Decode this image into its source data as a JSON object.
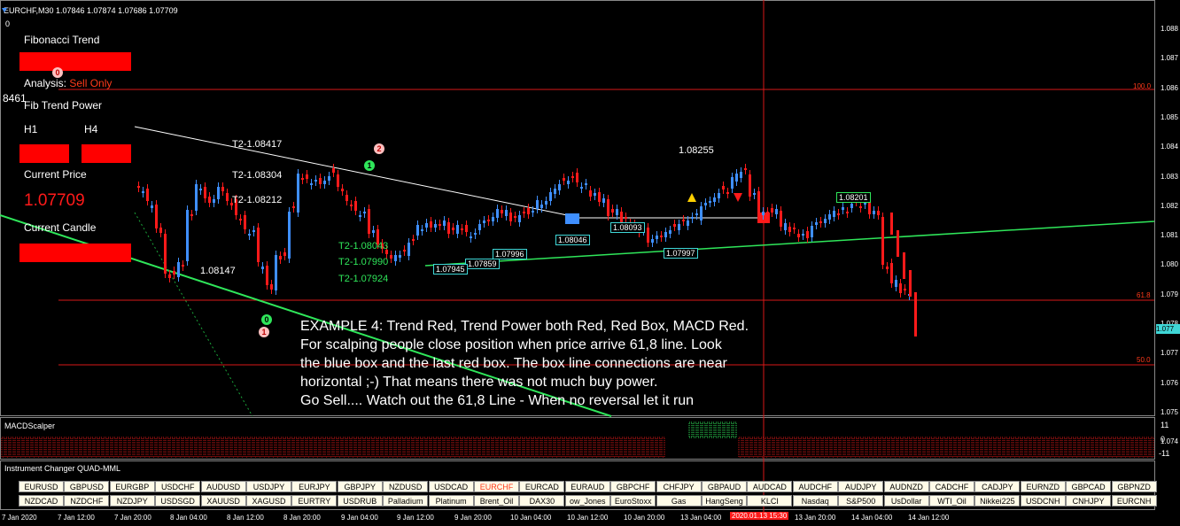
{
  "window": {
    "title": "EURCHF,M30  1.07846 1.07874 1.07686 1.07709",
    "zero_label": "0"
  },
  "panel": {
    "fib_trend": "Fibonacci Trend",
    "analysis_label": "Analysis:",
    "analysis_value": "Sell Only",
    "fib_trend_power": "Fib Trend Power",
    "h1": "H1",
    "h4": "H4",
    "current_price_label": "Current Price",
    "current_price_value": "1.07709",
    "current_candle": "Current Candle",
    "side_value": "8461"
  },
  "chart": {
    "annotations": {
      "t2_1": "T2-1.08417",
      "t2_2": "T2-1.08304",
      "t2_3": "T2-1.08212",
      "t2_4": "T2-1.08043",
      "t2_5": "T2-1.07990",
      "t2_6": "T2-1.07924",
      "low_label": "1.08147",
      "high_label": "1.08255",
      "box_1": "1.08046",
      "box_2": "1.08093",
      "box_3": "1.07996",
      "box_4": "1.07859",
      "box_5": "1.07945",
      "box_6": "1.07997",
      "box_7": "1.08201",
      "lvl_100": "100.0",
      "lvl_61": "61.8",
      "lvl_50": "50.0",
      "circle_0_top": "0",
      "circle_0_bottom": "0",
      "circle_1_bottom": "1",
      "circle_1_top": "1",
      "circle_2": "2"
    },
    "example_lines": [
      "EXAMPLE 4:  Trend Red, Trend Power both Red, Red Box, MACD Red.",
      "For scalping people close position when price arrive 61,8 line.  Look",
      "the blue box and the last red box. The box line connections are near",
      "horizontal ;-)  That means there was not much buy power.",
      "Go Sell.... Watch out the 61,8 Line - When no reversal let it run"
    ],
    "price_scale": [
      "1.088",
      "1.087",
      "1.086",
      "1.085",
      "1.084",
      "1.083",
      "1.082",
      "1.081",
      "1.080",
      "1.079",
      "1.078",
      "1.077",
      "1.076",
      "1.075",
      "1.074"
    ],
    "current_price_tag": "1.077"
  },
  "macd": {
    "title": "MACDScalper",
    "scale": [
      "11",
      "0",
      "-11"
    ]
  },
  "changer": {
    "title": "Instrument Changer QUAD-MML",
    "row1": [
      "EURUSD",
      "GBPUSD",
      "EURGBP",
      "USDCHF",
      "AUDUSD",
      "USDJPY",
      "EURJPY",
      "GBPJPY",
      "NZDUSD",
      "USDCAD",
      "EURCHF",
      "EURCAD",
      "EURAUD",
      "GBPCHF",
      "CHFJPY",
      "GBPAUD",
      "AUDCAD",
      "AUDCHF",
      "AUDJPY",
      "AUDNZD",
      "CADCHF",
      "CADJPY",
      "EURNZD",
      "GBPCAD",
      "GBPNZD"
    ],
    "row2": [
      "NZDCAD",
      "NZDCHF",
      "NZDJPY",
      "USDSGD",
      "XAUUSD",
      "XAGUSD",
      "EURTRY",
      "USDRUB",
      "Palladium",
      "Platinum",
      "Brent_Oil",
      "DAX30",
      "ow_Jones",
      "EuroStoxx",
      "Gas",
      "HangSeng",
      "KLCI",
      "Nasdaq",
      "S&P500",
      "UsDollar",
      "WTI_Oil",
      "Nikkei225",
      "USDCNH",
      "CNHJPY",
      "EURCNH"
    ],
    "active": "EURCHF"
  },
  "time_axis": [
    "7 Jan 2020",
    "7 Jan 12:00",
    "7 Jan 20:00",
    "8 Jan 04:00",
    "8 Jan 12:00",
    "8 Jan 20:00",
    "9 Jan 04:00",
    "9 Jan 12:00",
    "9 Jan 20:00",
    "10 Jan 04:00",
    "10 Jan 12:00",
    "10 Jan 20:00",
    "13 Jan 04:00",
    "2020.01.13 15:30",
    "13 Jan 20:00",
    "14 Jan 04:00",
    "14 Jan 12:00"
  ],
  "colors": {
    "bull": "#3f8fff",
    "bear": "#ff1a1a",
    "trend": "#2fe65a",
    "level": "#d81818"
  }
}
